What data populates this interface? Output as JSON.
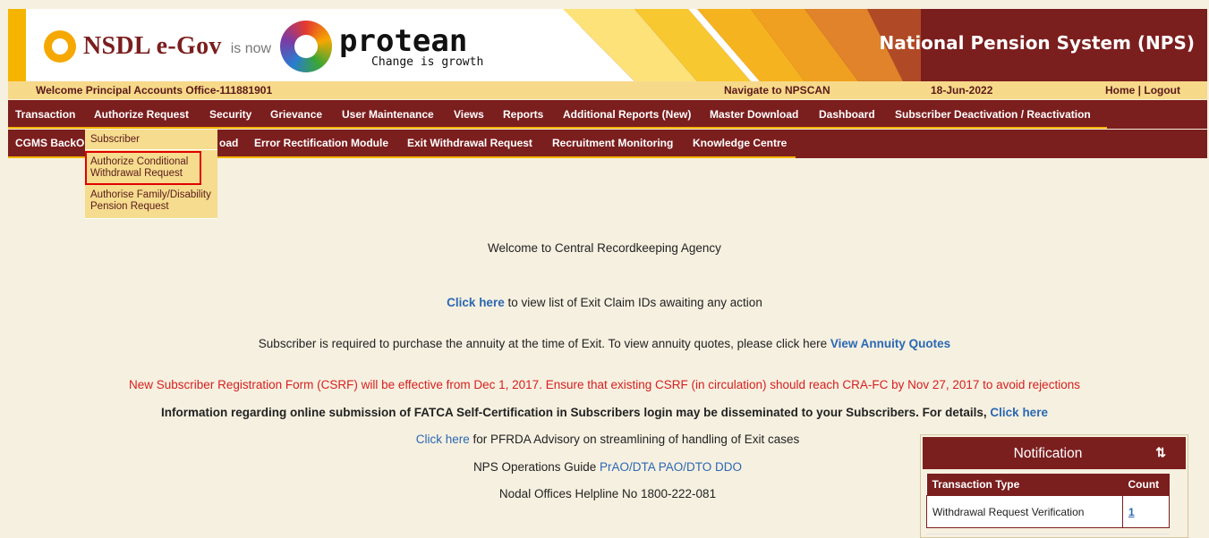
{
  "header": {
    "nsdl_text": "NSDL e-Gov",
    "is_now": "is now",
    "protean_name": "protean",
    "protean_tagline": "Change is growth",
    "title": "National Pension System (NPS)"
  },
  "welcome_bar": {
    "welcome": "Welcome Principal Accounts Office-111881901",
    "navigate": "Navigate to NPSCAN",
    "date": "18-Jun-2022",
    "home_logout": "Home | Logout"
  },
  "menu_row1": [
    "Transaction",
    "Authorize Request",
    "Security",
    "Grievance",
    "User Maintenance",
    "Views",
    "Reports",
    "Additional Reports (New)",
    "Master Download",
    "Dashboard",
    "Subscriber Deactivation / Reactivation"
  ],
  "menu_row2": {
    "cgms": "CGMS BackO",
    "upload_fragment": "oad",
    "error_rect": "Error Rectification Module",
    "exit_withdrawal": "Exit Withdrawal Request",
    "recruitment": "Recruitment Monitoring",
    "knowledge": "Knowledge Centre"
  },
  "dropdown": {
    "subscriber": "Subscriber",
    "conditional": "Authorize Conditional Withdrawal Request",
    "family": "Authorise Family/Disability Pension Request"
  },
  "main": {
    "welcome": "Welcome to Central Recordkeeping Agency",
    "exit_link": "Click here",
    "exit_text": " to view list of Exit Claim IDs awaiting any action",
    "annuity_text": "Subscriber is required to purchase the annuity at the time of Exit. To view annuity quotes, please click here ",
    "annuity_link": "View Annuity Quotes",
    "csrf_notice": "New Subscriber Registration Form (CSRF) will be effective from Dec 1, 2017. Ensure that existing CSRF (in circulation) should reach CRA-FC by Nov 27, 2017 to avoid rejections",
    "fatca_text": "Information regarding online submission of FATCA Self-Certification in Subscribers login may be disseminated to your Subscribers. For details, ",
    "fatca_link": "Click here",
    "pfrda_link": "Click here",
    "pfrda_text": " for PFRDA Advisory on streamlining of handling of Exit cases",
    "guide_text": "NPS Operations Guide ",
    "guide_link": "PrAO/DTA PAO/DTO DDO",
    "helpline": "Nodal Offices Helpline No 1800-222-081"
  },
  "notification": {
    "title": "Notification",
    "sort_icon": "sort-icon",
    "sort_glyph": "⇅",
    "col_type": "Transaction Type",
    "col_count": "Count",
    "rows": [
      {
        "type": "Withdrawal Request Verification",
        "count": "1"
      }
    ]
  },
  "colors": {
    "maroon": "#7b1e1e",
    "gold": "#f5b400",
    "cream": "#f6f0e0",
    "link_blue": "#2a68b4",
    "alert_red": "#d62020"
  }
}
